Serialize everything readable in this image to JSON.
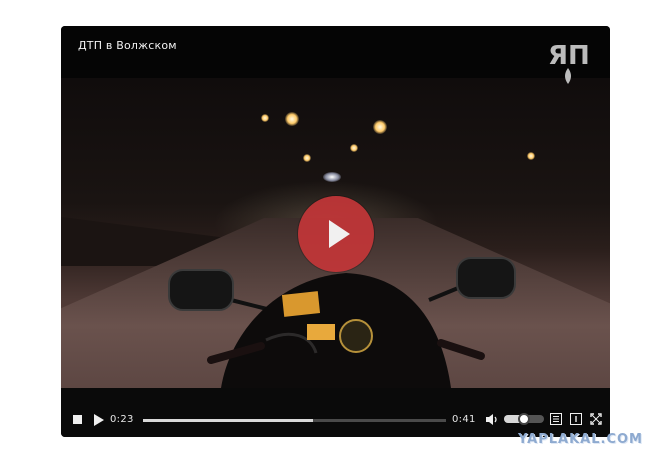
{
  "player": {
    "title": "ДТП в Волжском",
    "watermark_logo": "ЯП",
    "time_current": "0:23",
    "time_duration": "0:41",
    "progress_fraction": 0.56,
    "volume_fraction": 0.5
  },
  "icons": {
    "stop": "stop-icon",
    "play": "play-icon",
    "big_play": "big-play-icon",
    "volume": "speaker-icon",
    "playlist": "list-icon",
    "info": "info-icon",
    "fullscreen": "fullscreen-icon"
  },
  "colors": {
    "play_button": "#c23638",
    "player_bg": "#000000",
    "site_watermark": "#8eaad0"
  },
  "site": {
    "watermark": "YAPLAKAL.COM"
  }
}
